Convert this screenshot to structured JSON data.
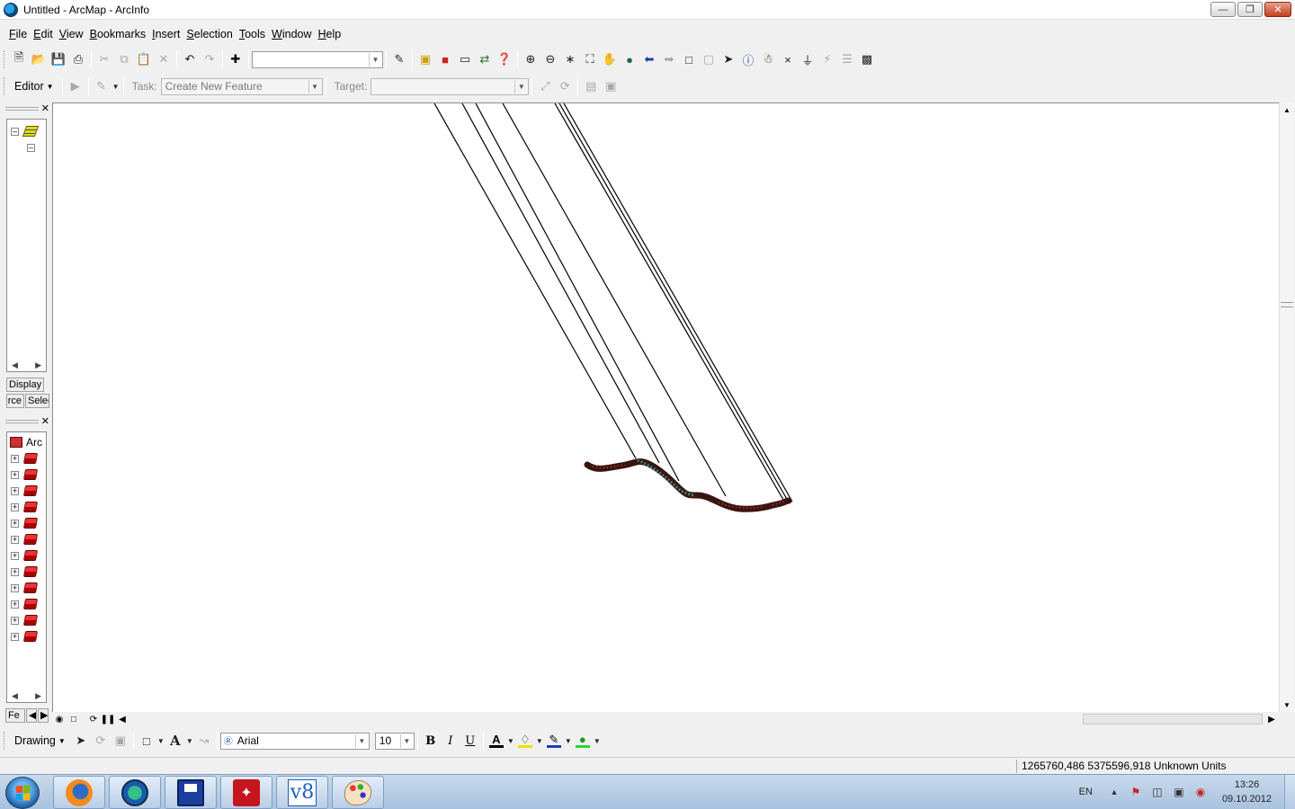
{
  "window": {
    "title": "Untitled - ArcMap - ArcInfo"
  },
  "menu": [
    "File",
    "Edit",
    "View",
    "Bookmarks",
    "Insert",
    "Selection",
    "Tools",
    "Window",
    "Help"
  ],
  "editor": {
    "editor_label": "Editor",
    "task_label": "Task:",
    "task_value": "Create New Feature",
    "target_label": "Target:",
    "target_value": ""
  },
  "standard_toolbar": {
    "scale_value": ""
  },
  "toc": {
    "tab_display": "Display",
    "tab_source": "ource",
    "tab_selection": "Selection",
    "layer_count": 12
  },
  "catalog": {
    "root_label": "Arc",
    "tab_label": "Fe"
  },
  "drawing": {
    "drawing_label": "Drawing",
    "font_value": "Arial",
    "size_value": "10",
    "bold": "B",
    "italic": "I",
    "underline": "U",
    "font_color_glyph": "A"
  },
  "status": {
    "coordinates": "1265760,486  5375596,918 Unknown Units"
  },
  "taskbar": {
    "language": "EN",
    "time": "13:26",
    "date": "09.10.2012"
  }
}
